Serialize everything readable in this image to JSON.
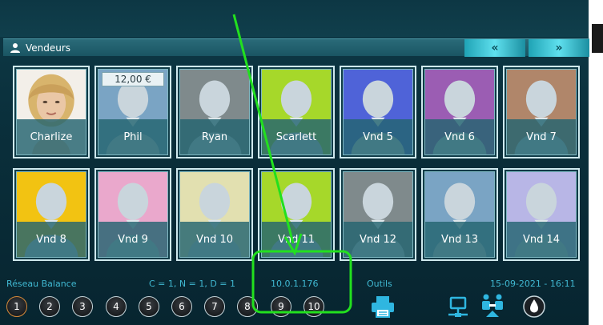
{
  "header": {
    "title": "Vendeurs",
    "prev_label": "«",
    "next_label": "»"
  },
  "vendors": [
    {
      "name": "Charlize",
      "color": "#ffffff",
      "photo": true
    },
    {
      "name": "Phil",
      "color": "#7aa4c4",
      "amount": "12,00 €"
    },
    {
      "name": "Ryan",
      "color": "#7f8a8c"
    },
    {
      "name": "Scarlett",
      "color": "#a6d82a"
    },
    {
      "name": "Vnd 5",
      "color": "#4f63d8"
    },
    {
      "name": "Vnd 6",
      "color": "#9b5db3"
    },
    {
      "name": "Vnd 7",
      "color": "#b0866a"
    },
    {
      "name": "Vnd 8",
      "color": "#f2c312"
    },
    {
      "name": "Vnd 9",
      "color": "#eaa8cc"
    },
    {
      "name": "Vnd 10",
      "color": "#e2e0b0"
    },
    {
      "name": "Vnd 11",
      "color": "#a6d82a"
    },
    {
      "name": "Vnd 12",
      "color": "#7f8a8c"
    },
    {
      "name": "Vnd 13",
      "color": "#7aa4c4"
    },
    {
      "name": "Vnd 14",
      "color": "#b8b6e6"
    }
  ],
  "status": {
    "network_label": "Réseau Balance",
    "counts": "C = 1, N = 1, D = 1",
    "ip": "10.0.1.176",
    "tools_label": "Outils",
    "datetime": "15-09-2021 - 16:11"
  },
  "scale_buttons": [
    "1",
    "2",
    "3",
    "4",
    "5",
    "6",
    "7",
    "8",
    "9",
    "10"
  ],
  "icons": {
    "header": "user-icon",
    "tools": [
      "printer-icon",
      "network-icon",
      "transfer-icon",
      "drop-icon"
    ]
  },
  "colors": {
    "accent": "#40b8d1",
    "annotation": "#22e01e"
  }
}
